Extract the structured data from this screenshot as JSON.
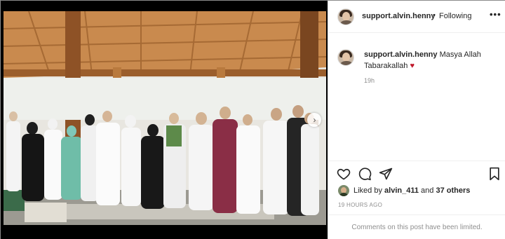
{
  "post": {
    "photo_description_icon": "group-photo",
    "username": "support.alvin.henny",
    "separator": "•",
    "follow_status": "Following",
    "more_icon": "more-options-icon"
  },
  "caption": {
    "username": "support.alvin.henny",
    "text": "Masya Allah Tabarakallah",
    "emoji": "♥",
    "time": "19h"
  },
  "actions": {
    "like_icon": "heart-outline-icon",
    "comment_icon": "comment-bubble-icon",
    "share_icon": "paper-plane-icon",
    "save_icon": "bookmark-icon"
  },
  "likes": {
    "prefix": "Liked by",
    "user": "alvin_411",
    "conjunction": "and",
    "others": "37 others"
  },
  "timestamp": "19 HOURS AGO",
  "comments_notice": "Comments on this post have been limited.",
  "colors": {
    "heart": "#c0192b",
    "muted": "#8e8e8e",
    "text": "#262626"
  }
}
